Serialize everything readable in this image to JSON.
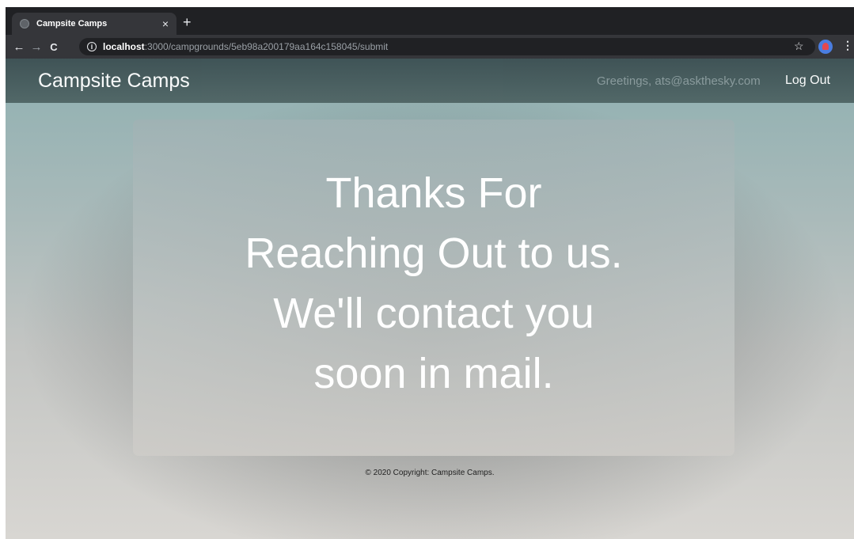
{
  "browser": {
    "tab": {
      "title": "Campsite Camps",
      "close_glyph": "×"
    },
    "new_tab_glyph": "+",
    "nav": {
      "back_glyph": "←",
      "forward_glyph": "→",
      "reload_glyph": "C"
    },
    "address": {
      "info_glyph": "i",
      "host": "localhost",
      "path": ":3000/campgrounds/5eb98a200179aa164c158045/submit"
    },
    "bookmark_glyph": "☆",
    "menu_glyph": "⋮"
  },
  "navbar": {
    "brand": "Campsite Camps",
    "greeting": "Greetings, ats@askthesky.com",
    "logout": "Log Out"
  },
  "card": {
    "lines": [
      "Thanks For",
      "Reaching Out to us.",
      "We'll contact you",
      "soon in mail."
    ]
  },
  "footer": {
    "text": "© 2020 Copyright: Campsite Camps."
  },
  "colors": {
    "navbar": "#3b4f52",
    "browser_dark": "#202124",
    "toolbar": "#35363a"
  }
}
